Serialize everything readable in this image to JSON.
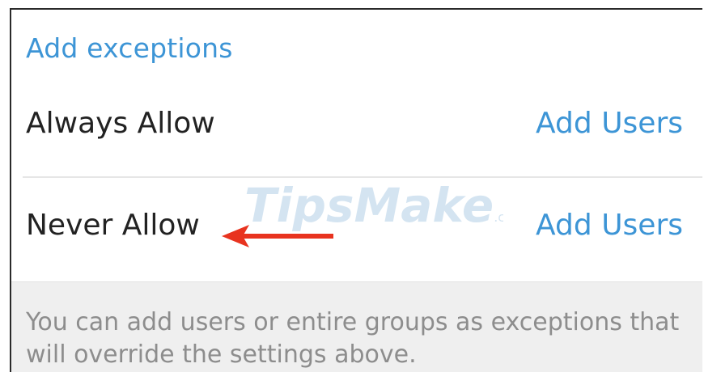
{
  "section": {
    "title": "Add exceptions"
  },
  "rows": [
    {
      "label": "Always Allow",
      "action": "Add Users"
    },
    {
      "label": "Never Allow",
      "action": "Add Users"
    }
  ],
  "footer": {
    "text": "You can add users or entire groups as exceptions that will override the settings above."
  },
  "watermark": {
    "brand_a": "Tips",
    "brand_b": "Make",
    "suffix": ".com"
  },
  "colors": {
    "accent": "#3d95d6",
    "arrow": "#e8331f",
    "footer_bg": "#efefef"
  }
}
